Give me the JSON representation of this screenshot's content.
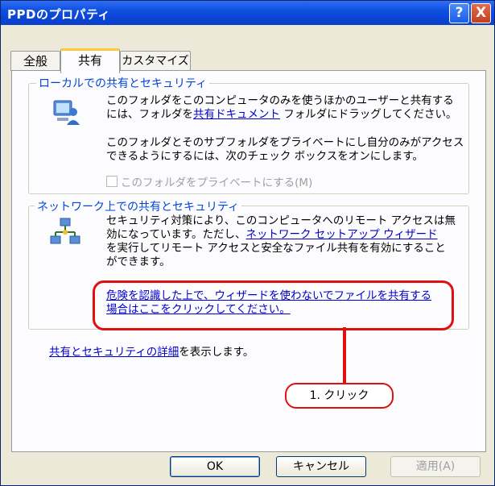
{
  "window": {
    "title": "PPDのプロパティ"
  },
  "titlebar_buttons": {
    "help": "?",
    "close": "X"
  },
  "tabs": [
    {
      "label": "全般"
    },
    {
      "label": "共有"
    },
    {
      "label": "カスタマイズ"
    }
  ],
  "local": {
    "title": "ローカルでの共有とセキュリティ",
    "line1": "このフォルダをこのコンピュータのみを使うほかのユーザーと共有する",
    "line2_pre": "には、フォルダを",
    "line2_link": "共有ドキュメント",
    "line2_post": " フォルダにドラッグしてください。",
    "line3": "このフォルダとそのサブフォルダをプライベートにし自分のみがアクセス",
    "line4": "できるようにするには、次のチェック ボックスをオンにします。",
    "checkbox_label": "このフォルダをプライベートにする(M)"
  },
  "network": {
    "title": "ネットワーク上での共有とセキュリティ",
    "line1": "セキュリティ対策により、このコンピュータへのリモート アクセスは無",
    "line2_pre": "効になっています。ただし、",
    "line2_link": "ネットワーク セットアップ ウィザード",
    "line3": "を実行してリモート アクセスと安全なファイル共有を有効にすること",
    "line4": "ができます。",
    "risk_link_line1": "危険を認識した上で、ウィザードを使わないでファイルを共有する",
    "risk_link_line2": "場合はここをクリックしてください。"
  },
  "details": {
    "link": "共有とセキュリティの詳細",
    "suffix": "を表示します。"
  },
  "annotation": {
    "label": "1. クリック",
    "color": "#e01010"
  },
  "buttons": {
    "ok": "OK",
    "cancel": "キャンセル",
    "apply": "適用(A)"
  }
}
